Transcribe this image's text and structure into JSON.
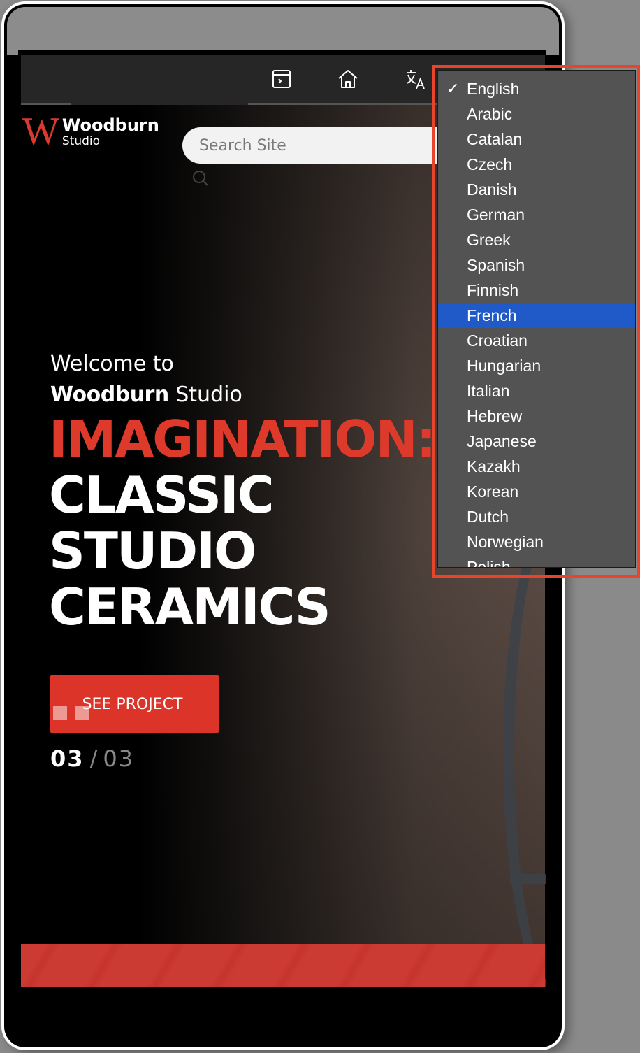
{
  "toolbar": {
    "icons": [
      "terminal-window-icon",
      "home-icon",
      "translate-icon"
    ]
  },
  "logo": {
    "mark": "W",
    "name": "Woodburn",
    "subtitle": "Studio"
  },
  "search": {
    "placeholder": "Search Site",
    "value": ""
  },
  "hero": {
    "welcome": "Welcome to",
    "brand_bold": "Woodburn",
    "brand_regular": "Studio",
    "headline_red": "IMAGINATION:",
    "headline_lines": [
      "CLASSIC",
      "STUDIO",
      "CERAMICS"
    ],
    "cta_label": "SEE PROJECT",
    "slide_current": "03",
    "slide_separator": "/",
    "slide_total": "03"
  },
  "colors": {
    "accent": "#dc3428",
    "dropdown_bg": "#535353",
    "dropdown_highlight": "#1f5ac8",
    "annotation_outline": "#e8432b"
  },
  "language_menu": {
    "selected": "English",
    "highlighted": "French",
    "check_glyph": "✓",
    "items": [
      "English",
      "Arabic",
      "Catalan",
      "Czech",
      "Danish",
      "German",
      "Greek",
      "Spanish",
      "Finnish",
      "French",
      "Croatian",
      "Hungarian",
      "Italian",
      "Hebrew",
      "Japanese",
      "Kazakh",
      "Korean",
      "Dutch",
      "Norwegian",
      "Polish"
    ]
  }
}
